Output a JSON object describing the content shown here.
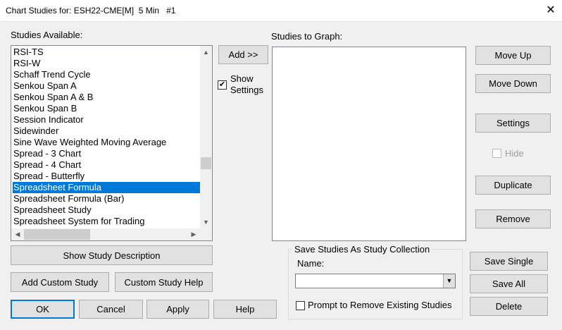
{
  "window": {
    "title": "Chart Studies for: ESH22-CME[M]  5 Min   #1",
    "close_glyph": "✕"
  },
  "studies_available": {
    "label": "Studies Available:",
    "items": [
      "RSI-TS",
      "RSI-W",
      "Schaff Trend Cycle",
      "Senkou Span A",
      "Senkou Span A & B",
      "Senkou Span B",
      "Session Indicator",
      "Sidewinder",
      "Sine Wave Weighted Moving Average",
      "Spread - 3 Chart",
      "Spread - 4 Chart",
      "Spread - Butterfly",
      "Spreadsheet Formula",
      "Spreadsheet Formula (Bar)",
      "Spreadsheet Study",
      "Spreadsheet System for Trading"
    ],
    "selected_index": 12
  },
  "middle": {
    "add_label": "Add >>",
    "show_settings_label_line1": "Show",
    "show_settings_label_line2": "Settings",
    "show_settings_checked": true,
    "check_glyph": "✔"
  },
  "studies_to_graph": {
    "label": "Studies to Graph:",
    "items": []
  },
  "right_buttons": {
    "move_up": "Move Up",
    "move_down": "Move Down",
    "settings": "Settings",
    "hide": "Hide",
    "duplicate": "Duplicate",
    "remove": "Remove"
  },
  "bottom_left": {
    "show_description": "Show Study Description",
    "add_custom": "Add Custom Study",
    "custom_help": "Custom Study Help",
    "ok": "OK",
    "cancel": "Cancel",
    "apply": "Apply",
    "help": "Help"
  },
  "collection": {
    "legend": "Save Studies As Study Collection",
    "name_label": "Name:",
    "name_value": "",
    "prompt_label": "Prompt to Remove Existing Studies",
    "prompt_checked": false,
    "save_single": "Save Single",
    "save_all": "Save All",
    "delete": "Delete"
  },
  "icons": {
    "scroll_up": "▲",
    "scroll_down": "▼",
    "scroll_left": "◀",
    "scroll_right": "▶",
    "combo_arrow": "▼"
  },
  "colors": {
    "selection": "#0078d7",
    "dialog_bg": "#f0f0f0",
    "button_bg": "#e1e1e1"
  }
}
